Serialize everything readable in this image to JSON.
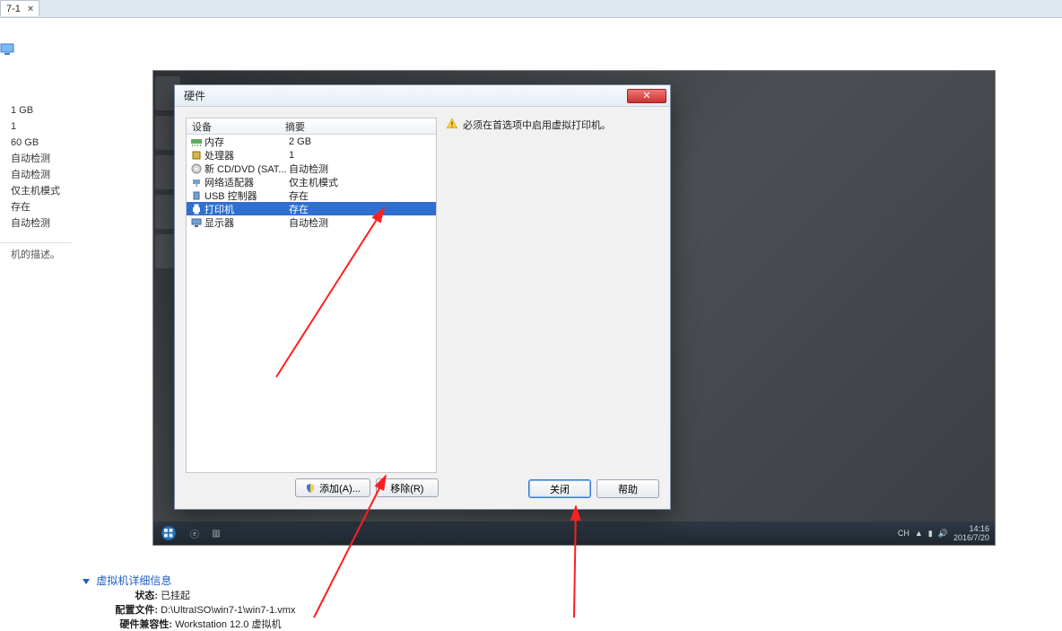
{
  "tab": {
    "title": "7-1"
  },
  "left_specs": [
    "1 GB",
    "1",
    "60 GB",
    "自动检测",
    "自动检测",
    "仅主机模式",
    "存在",
    "自动检测"
  ],
  "left_desc": "机的描述。",
  "dialog": {
    "title": "硬件",
    "header_device": "设备",
    "header_summary": "摘要",
    "rows": [
      {
        "name": "内存",
        "summary": "2 GB",
        "icon": "memory-icon"
      },
      {
        "name": "处理器",
        "summary": "1",
        "icon": "cpu-icon"
      },
      {
        "name": "新 CD/DVD (SAT...",
        "summary": "自动检测",
        "icon": "disc-icon"
      },
      {
        "name": "网络适配器",
        "summary": "仅主机模式",
        "icon": "network-icon"
      },
      {
        "name": "USB 控制器",
        "summary": "存在",
        "icon": "usb-icon"
      },
      {
        "name": "打印机",
        "summary": "存在",
        "icon": "printer-icon",
        "selected": true
      },
      {
        "name": "显示器",
        "summary": "自动检测",
        "icon": "display-icon"
      }
    ],
    "info_text": "必须在首选项中启用虚拟打印机。",
    "add_btn": "添加(A)...",
    "remove_btn": "移除(R)",
    "close_btn": "关闭",
    "help_btn": "帮助"
  },
  "taskbar": {
    "time": "14:16",
    "date": "2016/7/20",
    "lang": "CH"
  },
  "details": {
    "title": "虚拟机详细信息",
    "state_label": "状态:",
    "state_value": "已挂起",
    "config_label": "配置文件:",
    "config_value": "D:\\UltraISO\\win7-1\\win7-1.vmx",
    "compat_label": "硬件兼容性:",
    "compat_value": "Workstation 12.0 虚拟机"
  }
}
